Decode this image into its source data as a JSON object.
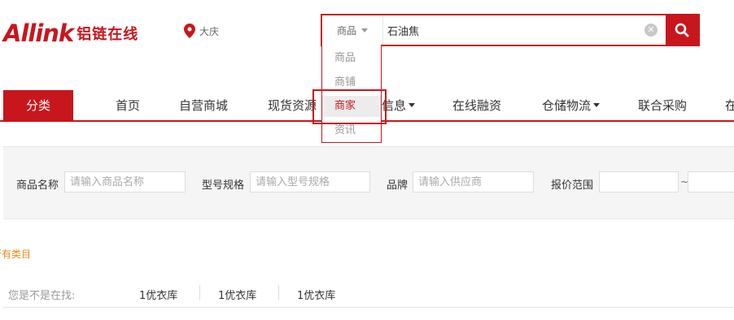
{
  "header": {
    "logo_text": "Allink",
    "logo_cn": "铝链在线",
    "location": "大庆",
    "colors": {
      "brand": "#c8161d"
    }
  },
  "search": {
    "type_selected": "商品",
    "query": "石油焦",
    "clear_icon": "clear-icon",
    "submit_icon": "search-icon",
    "dropdown_options": [
      "商品",
      "商铺",
      "商家",
      "资讯"
    ],
    "highlighted_option": "商家"
  },
  "nav": {
    "category": "分类",
    "items": [
      "首页",
      "自营商城",
      "现货资源",
      "信息",
      "在线融资",
      "仓储物流",
      "联合采购",
      "在"
    ]
  },
  "filter": {
    "name_label": "商品名称",
    "name_placeholder": "请输入商品名称",
    "spec_label": "型号规格",
    "spec_placeholder": "请输入型号规格",
    "brand_label": "品牌",
    "brand_placeholder": "请输入供应商",
    "price_label": "报价范围",
    "price_sep": "~"
  },
  "all_categories": "所有类目",
  "suggest": {
    "label": "您是不是在找:",
    "items": [
      "1优衣库",
      "1优衣库",
      "1优衣库"
    ]
  }
}
